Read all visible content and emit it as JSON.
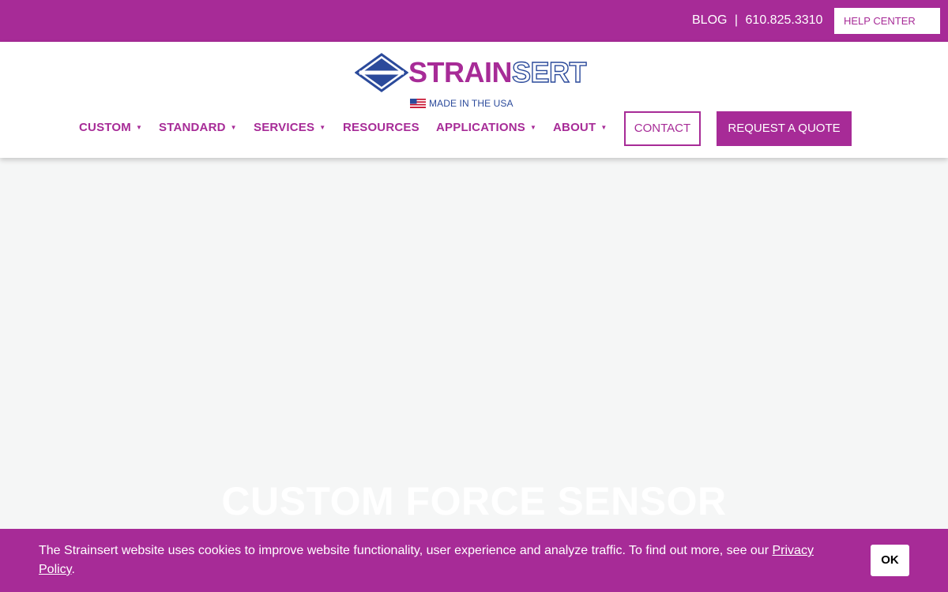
{
  "topbar": {
    "blog_label": "BLOG",
    "separator": "|",
    "phone": "610.825.3310",
    "help_center_label": "HELP CENTER"
  },
  "logo": {
    "word_primary": "STRAIN",
    "word_secondary": "SERT",
    "tagline": "MADE IN THE USA",
    "flag_icon": "us-flag-icon"
  },
  "nav": {
    "items": [
      {
        "label": "CUSTOM",
        "has_dropdown": true
      },
      {
        "label": "STANDARD",
        "has_dropdown": true
      },
      {
        "label": "SERVICES",
        "has_dropdown": true
      },
      {
        "label": "RESOURCES",
        "has_dropdown": false
      },
      {
        "label": "APPLICATIONS",
        "has_dropdown": true
      },
      {
        "label": "ABOUT",
        "has_dropdown": true
      }
    ],
    "caret": "▼",
    "contact_label": "CONTACT",
    "quote_label": "REQUEST A QUOTE"
  },
  "hero": {
    "title": "CUSTOM FORCE SENSOR"
  },
  "cookie": {
    "text": "The Strainsert website uses cookies to improve website functionality, user experience and analyze traffic. To find out more, see our ",
    "link_label": "Privacy Policy",
    "trailing": ".",
    "ok_label": "OK"
  },
  "colors": {
    "brand_purple": "#a72b97",
    "brand_blue": "#2b4a9b",
    "hero_bg": "#f5f6f6"
  }
}
